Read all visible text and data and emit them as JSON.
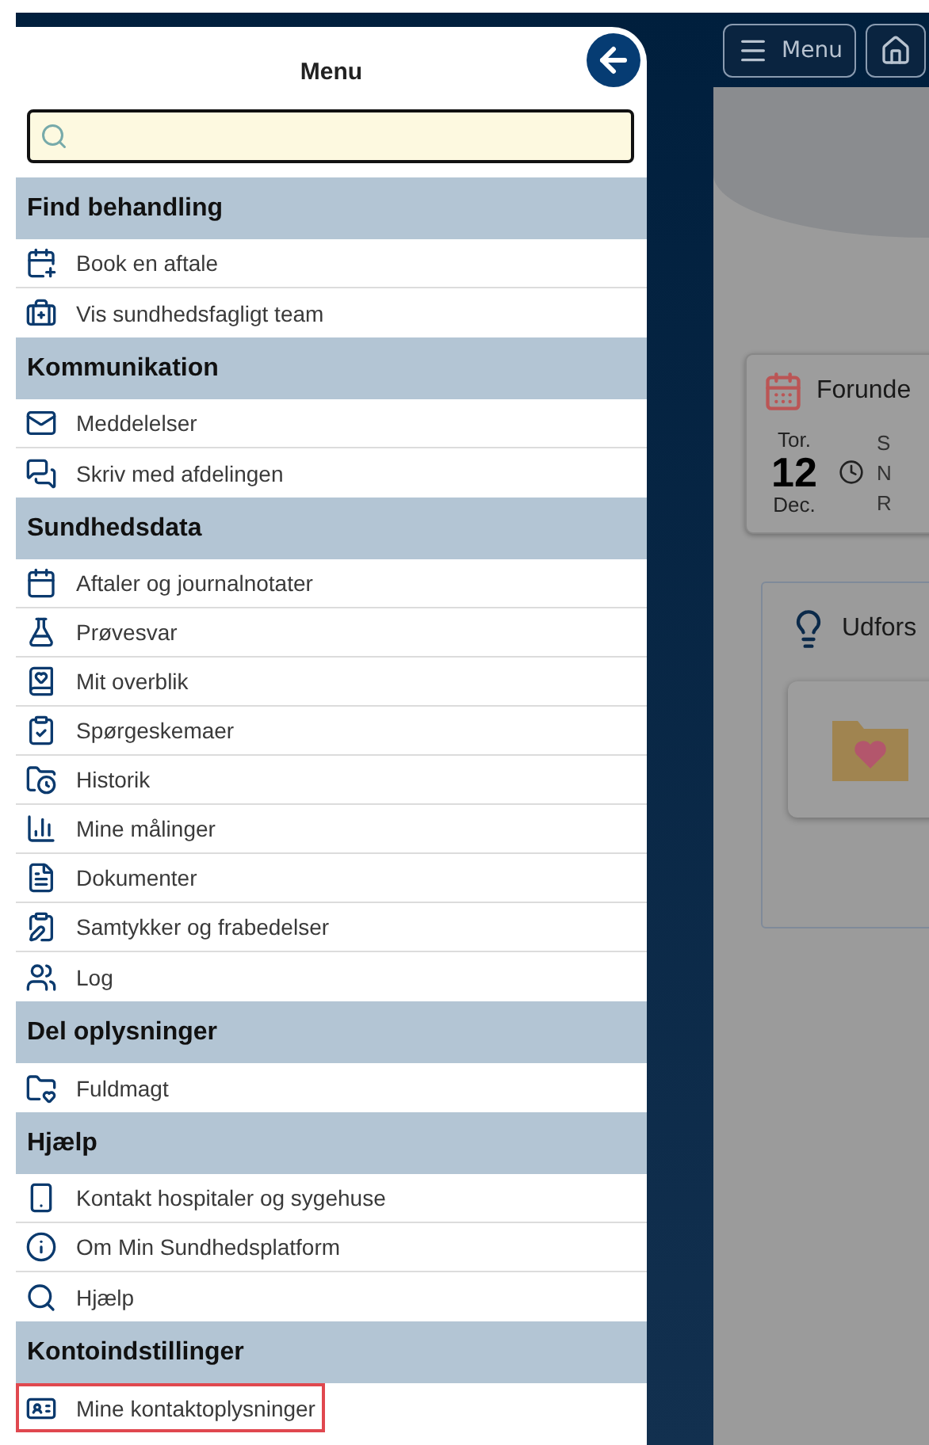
{
  "header": {
    "menu_button": "Menu"
  },
  "drawer": {
    "title": "Menu",
    "sections": [
      {
        "title": "Find behandling",
        "items": [
          {
            "label": "Book en aftale",
            "outlined": false
          },
          {
            "label": "Vis sundhedsfagligt team",
            "outlined": false
          }
        ]
      },
      {
        "title": "Kommunikation",
        "items": [
          {
            "label": "Meddelelser",
            "outlined": false
          },
          {
            "label": "Skriv med afdelingen",
            "outlined": false
          }
        ]
      },
      {
        "title": "Sundhedsdata",
        "items": [
          {
            "label": "Aftaler og journalnotater",
            "outlined": false
          },
          {
            "label": "Prøvesvar",
            "outlined": false
          },
          {
            "label": "Mit overblik",
            "outlined": false
          },
          {
            "label": "Spørgeskemaer",
            "outlined": false
          },
          {
            "label": "Historik",
            "outlined": false
          },
          {
            "label": "Mine målinger",
            "outlined": false
          },
          {
            "label": "Dokumenter",
            "outlined": false
          },
          {
            "label": "Samtykker og frabedelser",
            "outlined": false
          },
          {
            "label": "Log",
            "outlined": false
          }
        ]
      },
      {
        "title": "Del oplysninger",
        "items": [
          {
            "label": "Fuldmagt",
            "outlined": false
          }
        ]
      },
      {
        "title": "Hjælp",
        "items": [
          {
            "label": "Kontakt hospitaler og sygehuse",
            "outlined": false
          },
          {
            "label": "Om Min Sundhedsplatform",
            "outlined": false
          },
          {
            "label": "Hjælp",
            "outlined": false
          }
        ]
      },
      {
        "title": "Kontoindstillinger",
        "items": [
          {
            "label": "Mine kontaktoplysninger",
            "outlined": true
          }
        ]
      }
    ]
  },
  "background": {
    "appointment_card": {
      "title": "Forunde",
      "weekday": "Tor.",
      "day": "12",
      "month": "Dec.",
      "line_1": "S",
      "line_2": "N",
      "line_3": "R"
    },
    "explore_card": {
      "title": "Udfors"
    }
  }
}
